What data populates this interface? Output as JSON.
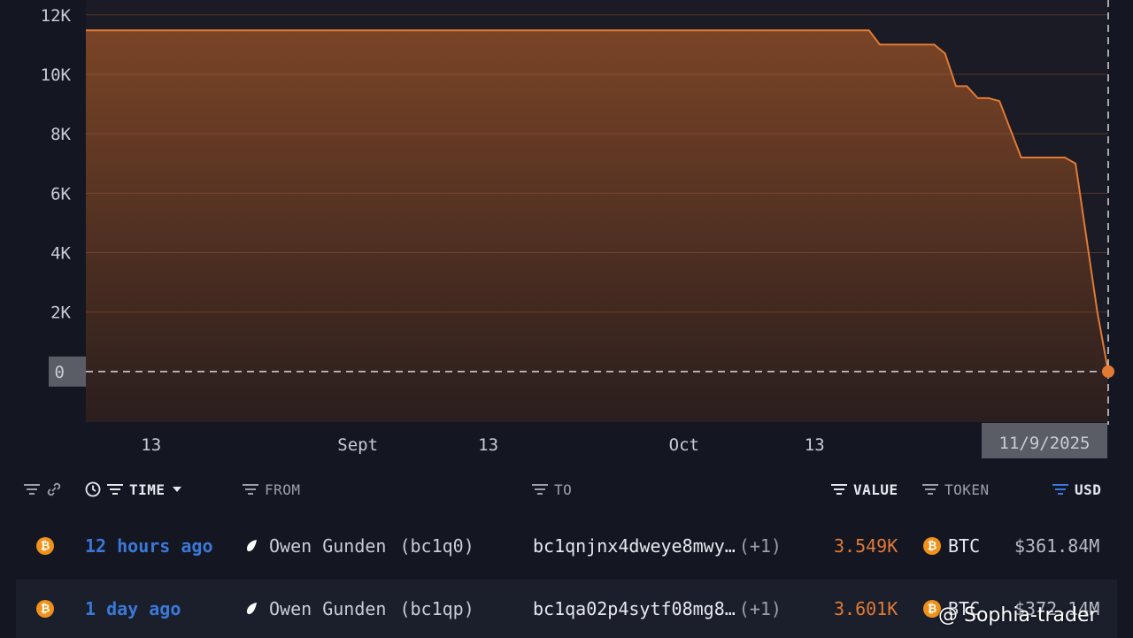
{
  "colors": {
    "background": "#141722",
    "area_top": "#7a4426",
    "area_bottom": "#2a1e1e",
    "line": "#e07a35",
    "time_link": "#3b78d8",
    "value": "#e07a35"
  },
  "chart_data": {
    "type": "area",
    "y_ticks": [
      "12K",
      "10K",
      "8K",
      "6K",
      "4K",
      "2K",
      "0"
    ],
    "y_tick_values": [
      12000,
      10000,
      8000,
      6000,
      4000,
      2000,
      0
    ],
    "ylim": [
      -1700,
      12500
    ],
    "x_ticks": [
      "13",
      "Sept",
      "13",
      "Oct",
      "13"
    ],
    "hover_date": "11/9/2025",
    "x_start": "2025-08-07",
    "x_end": "2025-11-09",
    "x_tick_dates": [
      "2025-08-13",
      "2025-09-01",
      "2025-09-13",
      "2025-10-01",
      "2025-10-13"
    ],
    "series": [
      {
        "x": [
          "2025-08-07",
          "2025-10-18",
          "2025-10-19",
          "2025-10-24",
          "2025-10-25",
          "2025-10-26",
          "2025-10-27",
          "2025-10-28",
          "2025-10-29",
          "2025-10-30",
          "2025-11-01",
          "2025-11-02",
          "2025-11-05",
          "2025-11-06",
          "2025-11-08",
          "2025-11-09"
        ],
        "y": [
          11480,
          11480,
          11000,
          11000,
          10700,
          9600,
          9600,
          9200,
          9200,
          9100,
          7200,
          7200,
          7200,
          7000,
          2000,
          0
        ]
      }
    ],
    "grid": true
  },
  "table": {
    "headers": {
      "time": "TIME",
      "from": "FROM",
      "to": "TO",
      "value": "VALUE",
      "token": "TOKEN",
      "usd": "USD"
    },
    "rows": [
      {
        "time": "12 hours ago",
        "from_name": "Owen Gunden",
        "from_addr": "(bc1q0)",
        "to": "bc1qnjnx4dweye8mwy…",
        "to_extra": "(+1)",
        "value": "3.549K",
        "token": "BTC",
        "usd": "$361.84M"
      },
      {
        "time": "1 day ago",
        "from_name": "Owen Gunden",
        "from_addr": "(bc1qp)",
        "to": "bc1qa02p4sytf08mg8…",
        "to_extra": "(+1)",
        "value": "3.601K",
        "token": "BTC",
        "usd": "$372.14M"
      }
    ]
  },
  "watermark": "@ Sophia-trader"
}
